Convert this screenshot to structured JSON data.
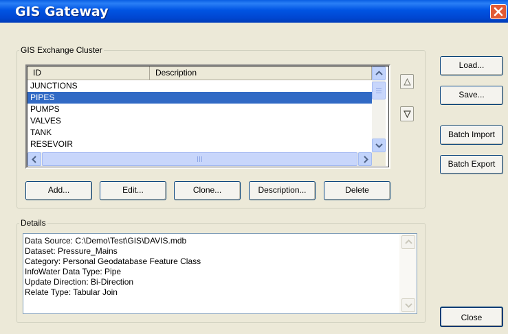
{
  "window": {
    "title": "GIS Gateway"
  },
  "cluster": {
    "legend": "GIS Exchange Cluster",
    "columns": [
      "ID",
      "Description"
    ],
    "rows": [
      {
        "id": "JUNCTIONS",
        "description": ""
      },
      {
        "id": "PIPES",
        "description": "",
        "selected": true
      },
      {
        "id": "PUMPS",
        "description": ""
      },
      {
        "id": "VALVES",
        "description": ""
      },
      {
        "id": "TANK",
        "description": ""
      },
      {
        "id": "RESEVOIR",
        "description": ""
      }
    ],
    "buttons": {
      "add": "Add...",
      "edit": "Edit...",
      "clone": "Clone...",
      "description": "Description...",
      "delete": "Delete"
    }
  },
  "side_buttons": {
    "load": "Load...",
    "save": "Save...",
    "batch_import": "Batch Import",
    "batch_export": "Batch Export",
    "close": "Close"
  },
  "details": {
    "legend": "Details",
    "lines": [
      "Data Source: C:\\Demo\\Test\\GIS\\DAVIS.mdb",
      "Dataset: Pressure_Mains",
      "Category: Personal Geodatabase Feature Class",
      "InfoWater Data Type: Pipe",
      "Update Direction: Bi-Direction",
      "Relate Type: Tabular Join"
    ]
  },
  "colors": {
    "title_bar": "#0054e3",
    "selection": "#316ac5",
    "dialog_bg": "#ece9d8",
    "close_button": "#e25a35"
  },
  "icons": {
    "close": "close-icon",
    "move_up": "triangle-up-icon",
    "move_down": "triangle-down-icon"
  }
}
